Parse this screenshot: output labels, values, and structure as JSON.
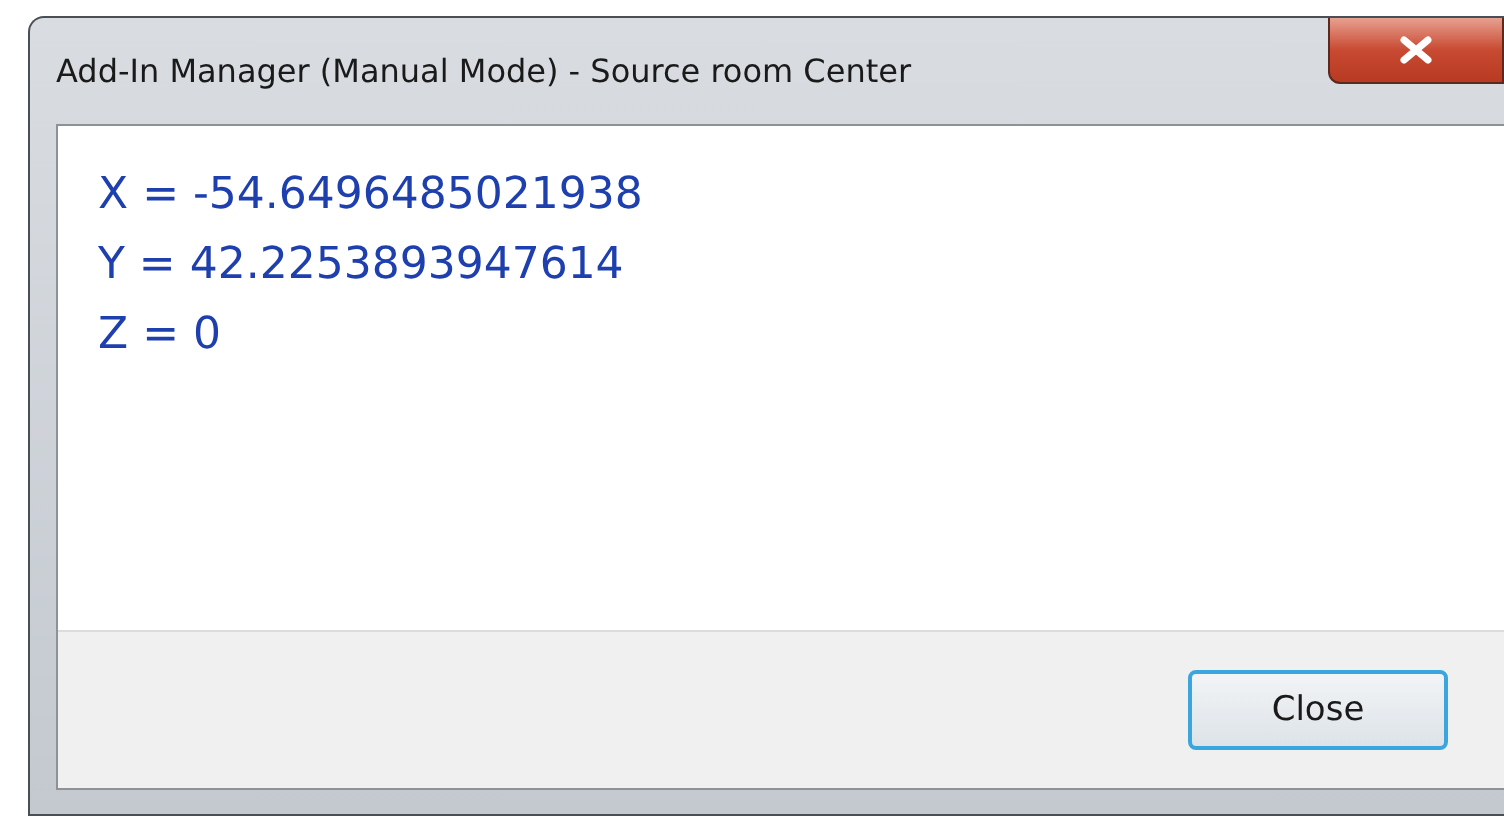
{
  "window": {
    "title": "Add-In Manager (Manual Mode) - Source room Center"
  },
  "lines": [
    "X = -54.6496485021938",
    "Y = 42.2253893947614",
    "Z = 0"
  ],
  "buttons": [
    {
      "label": "Close",
      "kind": "default"
    }
  ]
}
